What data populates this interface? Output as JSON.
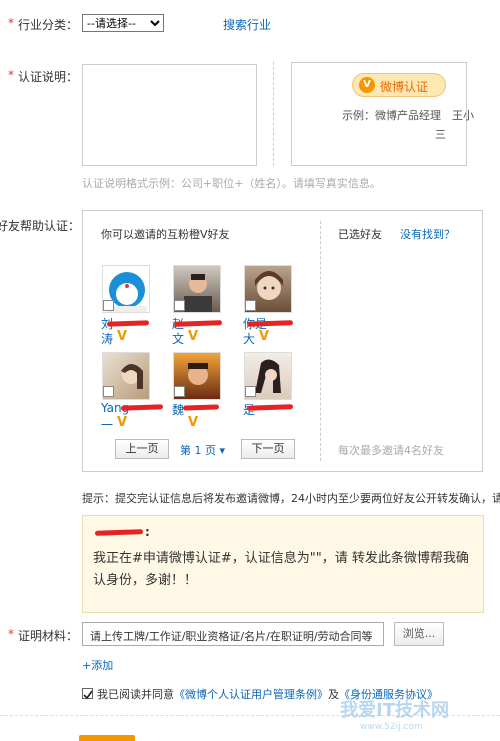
{
  "industry": {
    "required_mark": "*",
    "label": "行业分类：",
    "select_value": "--请选择--",
    "search_link": "搜索行业"
  },
  "description": {
    "required_mark": "*",
    "label": "认证说明：",
    "hint": "认证说明格式示例：公司+职位+（姓名）。请填写真实信息。",
    "badge_text": "微博认证",
    "badge_v": "V",
    "example_line1": "示例：微博产品经理　王小",
    "example_line2": "三"
  },
  "friends": {
    "label": "好友帮助认证：",
    "invite_title": "你可以邀请的互粉橙V好友",
    "selected_title": "已选好友",
    "not_found_link": "没有找到？",
    "max_hint": "每次最多邀请4名好友",
    "v_mark": "V",
    "list": [
      {
        "name_line1": "刘",
        "name_line2": "涛"
      },
      {
        "name_line1": "赵",
        "name_line2": "文"
      },
      {
        "name_line1": "你是",
        "name_line2": "大"
      },
      {
        "name_line1": "Yang",
        "name_line2": "一"
      },
      {
        "name_line1": "魏",
        "name_line2": ""
      },
      {
        "name_line1": "是",
        "name_line2": ""
      }
    ],
    "prev_page": "上一页",
    "page_indicator": "第 1 页 ▾",
    "next_page": "下一页"
  },
  "tip": "提示：提交完认证信息后将发布邀请微博，24小时内至少要两位好友公开转发确认，请",
  "quote": {
    "author_suffix": ":",
    "body": "我正在#申请微博认证#，认证信息为\"\"，请 转发此条微博帮我确认身份，多谢！！"
  },
  "proof": {
    "required_mark": "*",
    "label": "证明材料：",
    "upload_placeholder": "请上传工牌/工作证/职业资格证/名片/在职证明/劳动合同等",
    "browse_button": "浏览...",
    "add_link": "+添加"
  },
  "agreement": {
    "prefix": "我已阅读并同意",
    "link1": "《微博个人认证用户管理条例》",
    "middle": "及",
    "link2": "《身份通服务协议》"
  },
  "watermark": {
    "line1": "我爱IT技术网",
    "line2": "www.52ij.com"
  },
  "colors": {
    "required": "#e4393c",
    "link": "#0a66b7",
    "orange_v": "#f39800",
    "redaction": "#e62222"
  }
}
